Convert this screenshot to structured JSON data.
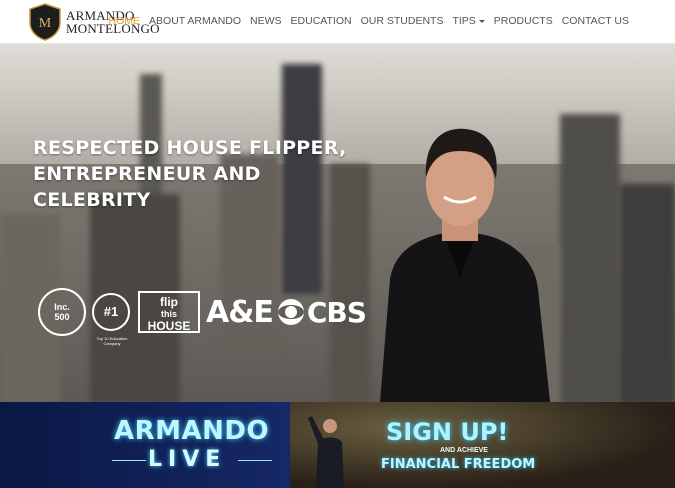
{
  "logo": {
    "line1": "ARMANDO",
    "line2": "MONTELONGO",
    "monogram": "M"
  },
  "nav": {
    "items": [
      {
        "label": "HOME",
        "active": true
      },
      {
        "label": "ABOUT ARMANDO",
        "active": false
      },
      {
        "label": "NEWS",
        "active": false
      },
      {
        "label": "EDUCATION",
        "active": false
      },
      {
        "label": "OUR STUDENTS",
        "active": false
      },
      {
        "label": "TIPS",
        "active": false,
        "dropdown": true
      },
      {
        "label": "PRODUCTS",
        "active": false
      },
      {
        "label": "CONTACT US",
        "active": false
      }
    ]
  },
  "hero": {
    "title_line1": "RESPECTED HOUSE FLIPPER,",
    "title_line2": "ENTREPRENEUR AND",
    "title_line3": "CELEBRITY",
    "badges": {
      "inc_top": "Inc.",
      "inc_bottom": "500",
      "number_one": "#1",
      "number_one_caption": "Top 10 Education Company",
      "flip_line1": "flip",
      "flip_line2": "this",
      "flip_line3": "HOUSE",
      "ae": "A&E",
      "cbs": "CBS"
    }
  },
  "banner": {
    "live_title": "ARMANDO",
    "live_sub": "LIVE",
    "signup": "SIGN UP!",
    "and_achieve": "AND ACHIEVE",
    "financial_freedom": "FINANCIAL FREEDOM"
  },
  "colors": {
    "accent": "#e8a128",
    "nav_text": "#555555",
    "glow": "#3fd0ff"
  }
}
